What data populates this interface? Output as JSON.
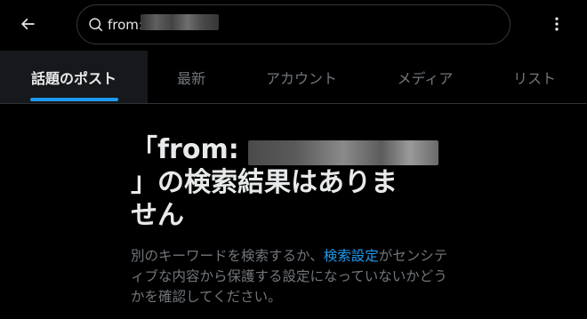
{
  "header": {
    "search": {
      "value": "from:"
    }
  },
  "tabs": [
    {
      "label": "話題のポスト",
      "active": true
    },
    {
      "label": "最新",
      "active": false
    },
    {
      "label": "アカウント",
      "active": false
    },
    {
      "label": "メディア",
      "active": false
    },
    {
      "label": "リスト",
      "active": false
    }
  ],
  "result": {
    "title_line1": "「from:",
    "title_line2": "」の検索結果はありま",
    "title_line3": "せん",
    "desc_before": "別のキーワードを検索するか、",
    "desc_link": "検索設定",
    "desc_after": "がセンシティブな内容から保護する設定になっていないかどうかを確認してください。"
  },
  "colors": {
    "background": "#000000",
    "text_primary": "#e7e9ea",
    "text_secondary": "#71767b",
    "accent": "#1d9bf0",
    "border": "#2f3336"
  }
}
